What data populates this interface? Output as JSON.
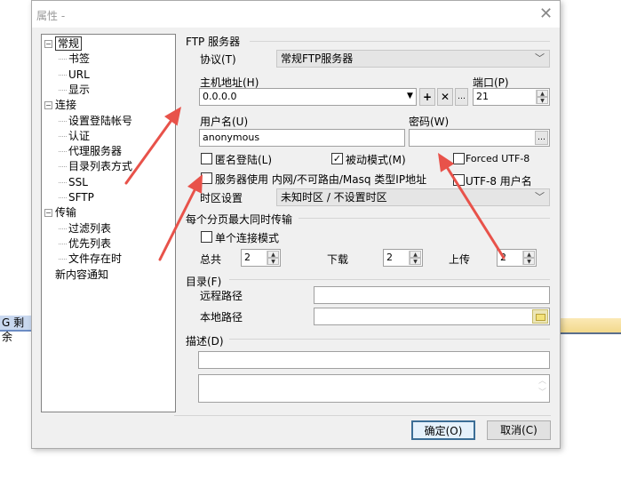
{
  "background": {
    "left_bar_text": "G 剩余"
  },
  "dialog": {
    "title": "属性 -"
  },
  "tree": [
    {
      "label": "常规",
      "level": 0,
      "expander": "⊟",
      "selected": true
    },
    {
      "label": "书签",
      "level": 1
    },
    {
      "label": "URL",
      "level": 1
    },
    {
      "label": "显示",
      "level": 1
    },
    {
      "label": "连接",
      "level": 0,
      "expander": "⊟"
    },
    {
      "label": "设置登陆帐号",
      "level": 1
    },
    {
      "label": "认证",
      "level": 1
    },
    {
      "label": "代理服务器",
      "level": 1
    },
    {
      "label": "目录列表方式",
      "level": 1
    },
    {
      "label": "SSL",
      "level": 1
    },
    {
      "label": "SFTP",
      "level": 1
    },
    {
      "label": "传输",
      "level": 0,
      "expander": "⊟"
    },
    {
      "label": "过滤列表",
      "level": 1
    },
    {
      "label": "优先列表",
      "level": 1
    },
    {
      "label": "文件存在时",
      "level": 1
    },
    {
      "label": "新内容通知",
      "level": 0
    }
  ],
  "ftp": {
    "group_label": "FTP 服务器",
    "protocol_label": "协议(T)",
    "protocol_value": "常规FTP服务器",
    "host_label": "主机地址(H)",
    "host_value": "0.0.0.0",
    "host_buttons": {
      "add": "+",
      "remove": "✕",
      "more": "…"
    },
    "port_label": "端口(P)",
    "port_value": "21",
    "user_label": "用户名(U)",
    "user_value": "anonymous",
    "pass_label": "密码(W)",
    "pass_value": "",
    "pass_more": "…",
    "anonymous_label": "匿名登陆(L)",
    "anonymous_checked": false,
    "passive_label": "被动模式(M)",
    "passive_checked": true,
    "forced_utf8_label": "Forced UTF-8",
    "forced_utf8_checked": false,
    "masq_label": "服务器使用 内网/不可路由/Masq 类型IP地址",
    "masq_checked": false,
    "utf8_user_label": "UTF-8 用户名",
    "utf8_user_checked": false,
    "timezone_label": "时区设置",
    "timezone_value": "未知时区 / 不设置时区"
  },
  "transfer": {
    "group_label": "每个分页最大同时传输",
    "single_label": "单个连接模式",
    "single_checked": false,
    "total_label": "总共",
    "total_value": "2",
    "download_label": "下载",
    "download_value": "2",
    "upload_label": "上传",
    "upload_value": "2"
  },
  "dir": {
    "group_label": "目录(F)",
    "remote_label": "远程路径",
    "remote_value": "",
    "local_label": "本地路径",
    "local_value": ""
  },
  "desc": {
    "group_label": "描述(D)",
    "line_value": "",
    "text_value": ""
  },
  "buttons": {
    "ok": "确定(O)",
    "cancel": "取消(C)"
  },
  "colors": {
    "arrow": "#e8524a",
    "dialog_bg": "#f0f0f0"
  }
}
